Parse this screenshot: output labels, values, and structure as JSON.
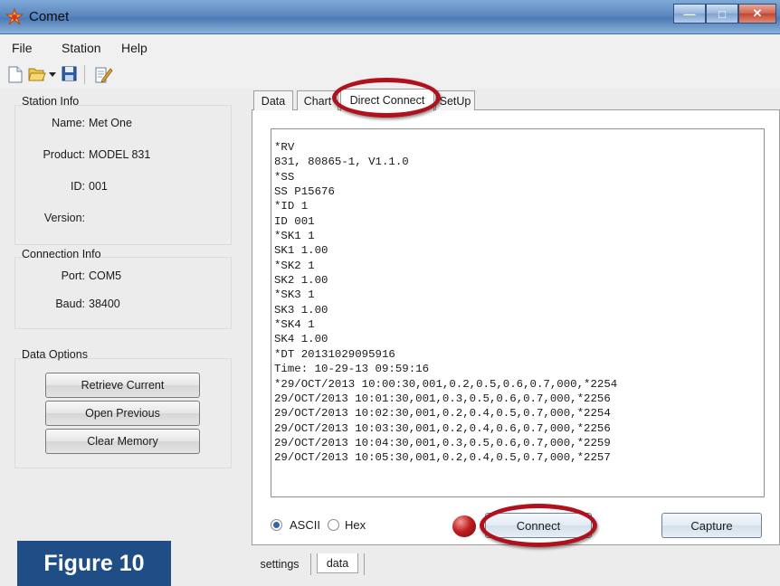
{
  "window": {
    "title": "Comet"
  },
  "menu": [
    "File",
    "Station",
    "Help"
  ],
  "toolbar": {
    "icons": [
      "new-file-icon",
      "open-folder-icon",
      "save-icon",
      "edit-icon"
    ]
  },
  "station_info": {
    "label": "Station Info",
    "fields": [
      {
        "key": "Name:",
        "value": "Met One"
      },
      {
        "key": "Product:",
        "value": "MODEL 831"
      },
      {
        "key": "ID:",
        "value": "001"
      },
      {
        "key": "Version:",
        "value": ""
      }
    ]
  },
  "connection_info": {
    "label": "Connection Info",
    "fields": [
      {
        "key": "Port:",
        "value": "COM5"
      },
      {
        "key": "Baud:",
        "value": "38400"
      }
    ]
  },
  "data_options": {
    "label": "Data Options",
    "buttons": [
      "Retrieve Current",
      "Open Previous",
      "Clear Memory"
    ]
  },
  "tabs": [
    "Data",
    "Chart",
    "Direct Connect",
    "SetUp"
  ],
  "terminal": {
    "lines": [
      "*RV",
      "831, 80865-1, V1.1.0",
      "*SS",
      "SS P15676",
      "*ID 1",
      "ID 001",
      "*SK1 1",
      "SK1 1.00",
      "*SK2 1",
      "SK2 1.00",
      "*SK3 1",
      "SK3 1.00",
      "*SK4 1",
      "SK4 1.00",
      "*DT 20131029095916",
      "Time: 10-29-13 09:59:16",
      "*29/OCT/2013 10:00:30,001,0.2,0.5,0.6,0.7,000,*2254",
      "29/OCT/2013 10:01:30,001,0.3,0.5,0.6,0.7,000,*2256",
      "29/OCT/2013 10:02:30,001,0.2,0.4,0.5,0.7,000,*2254",
      "29/OCT/2013 10:03:30,001,0.2,0.4,0.6,0.7,000,*2256",
      "29/OCT/2013 10:04:30,001,0.3,0.5,0.6,0.7,000,*2259",
      "29/OCT/2013 10:05:30,001,0.2,0.4,0.5,0.7,000,*2257"
    ]
  },
  "mode": {
    "ascii": "ASCII",
    "hex": "Hex",
    "selected": "ASCII"
  },
  "actions": {
    "connect": "Connect",
    "capture": "Capture"
  },
  "bottom_tabs": [
    "settings",
    "data"
  ],
  "figure_label": "Figure 10",
  "colors": {
    "highlight": "#b0121d",
    "figure_bg": "#1f4e87",
    "status_led": "#c11f1f"
  }
}
